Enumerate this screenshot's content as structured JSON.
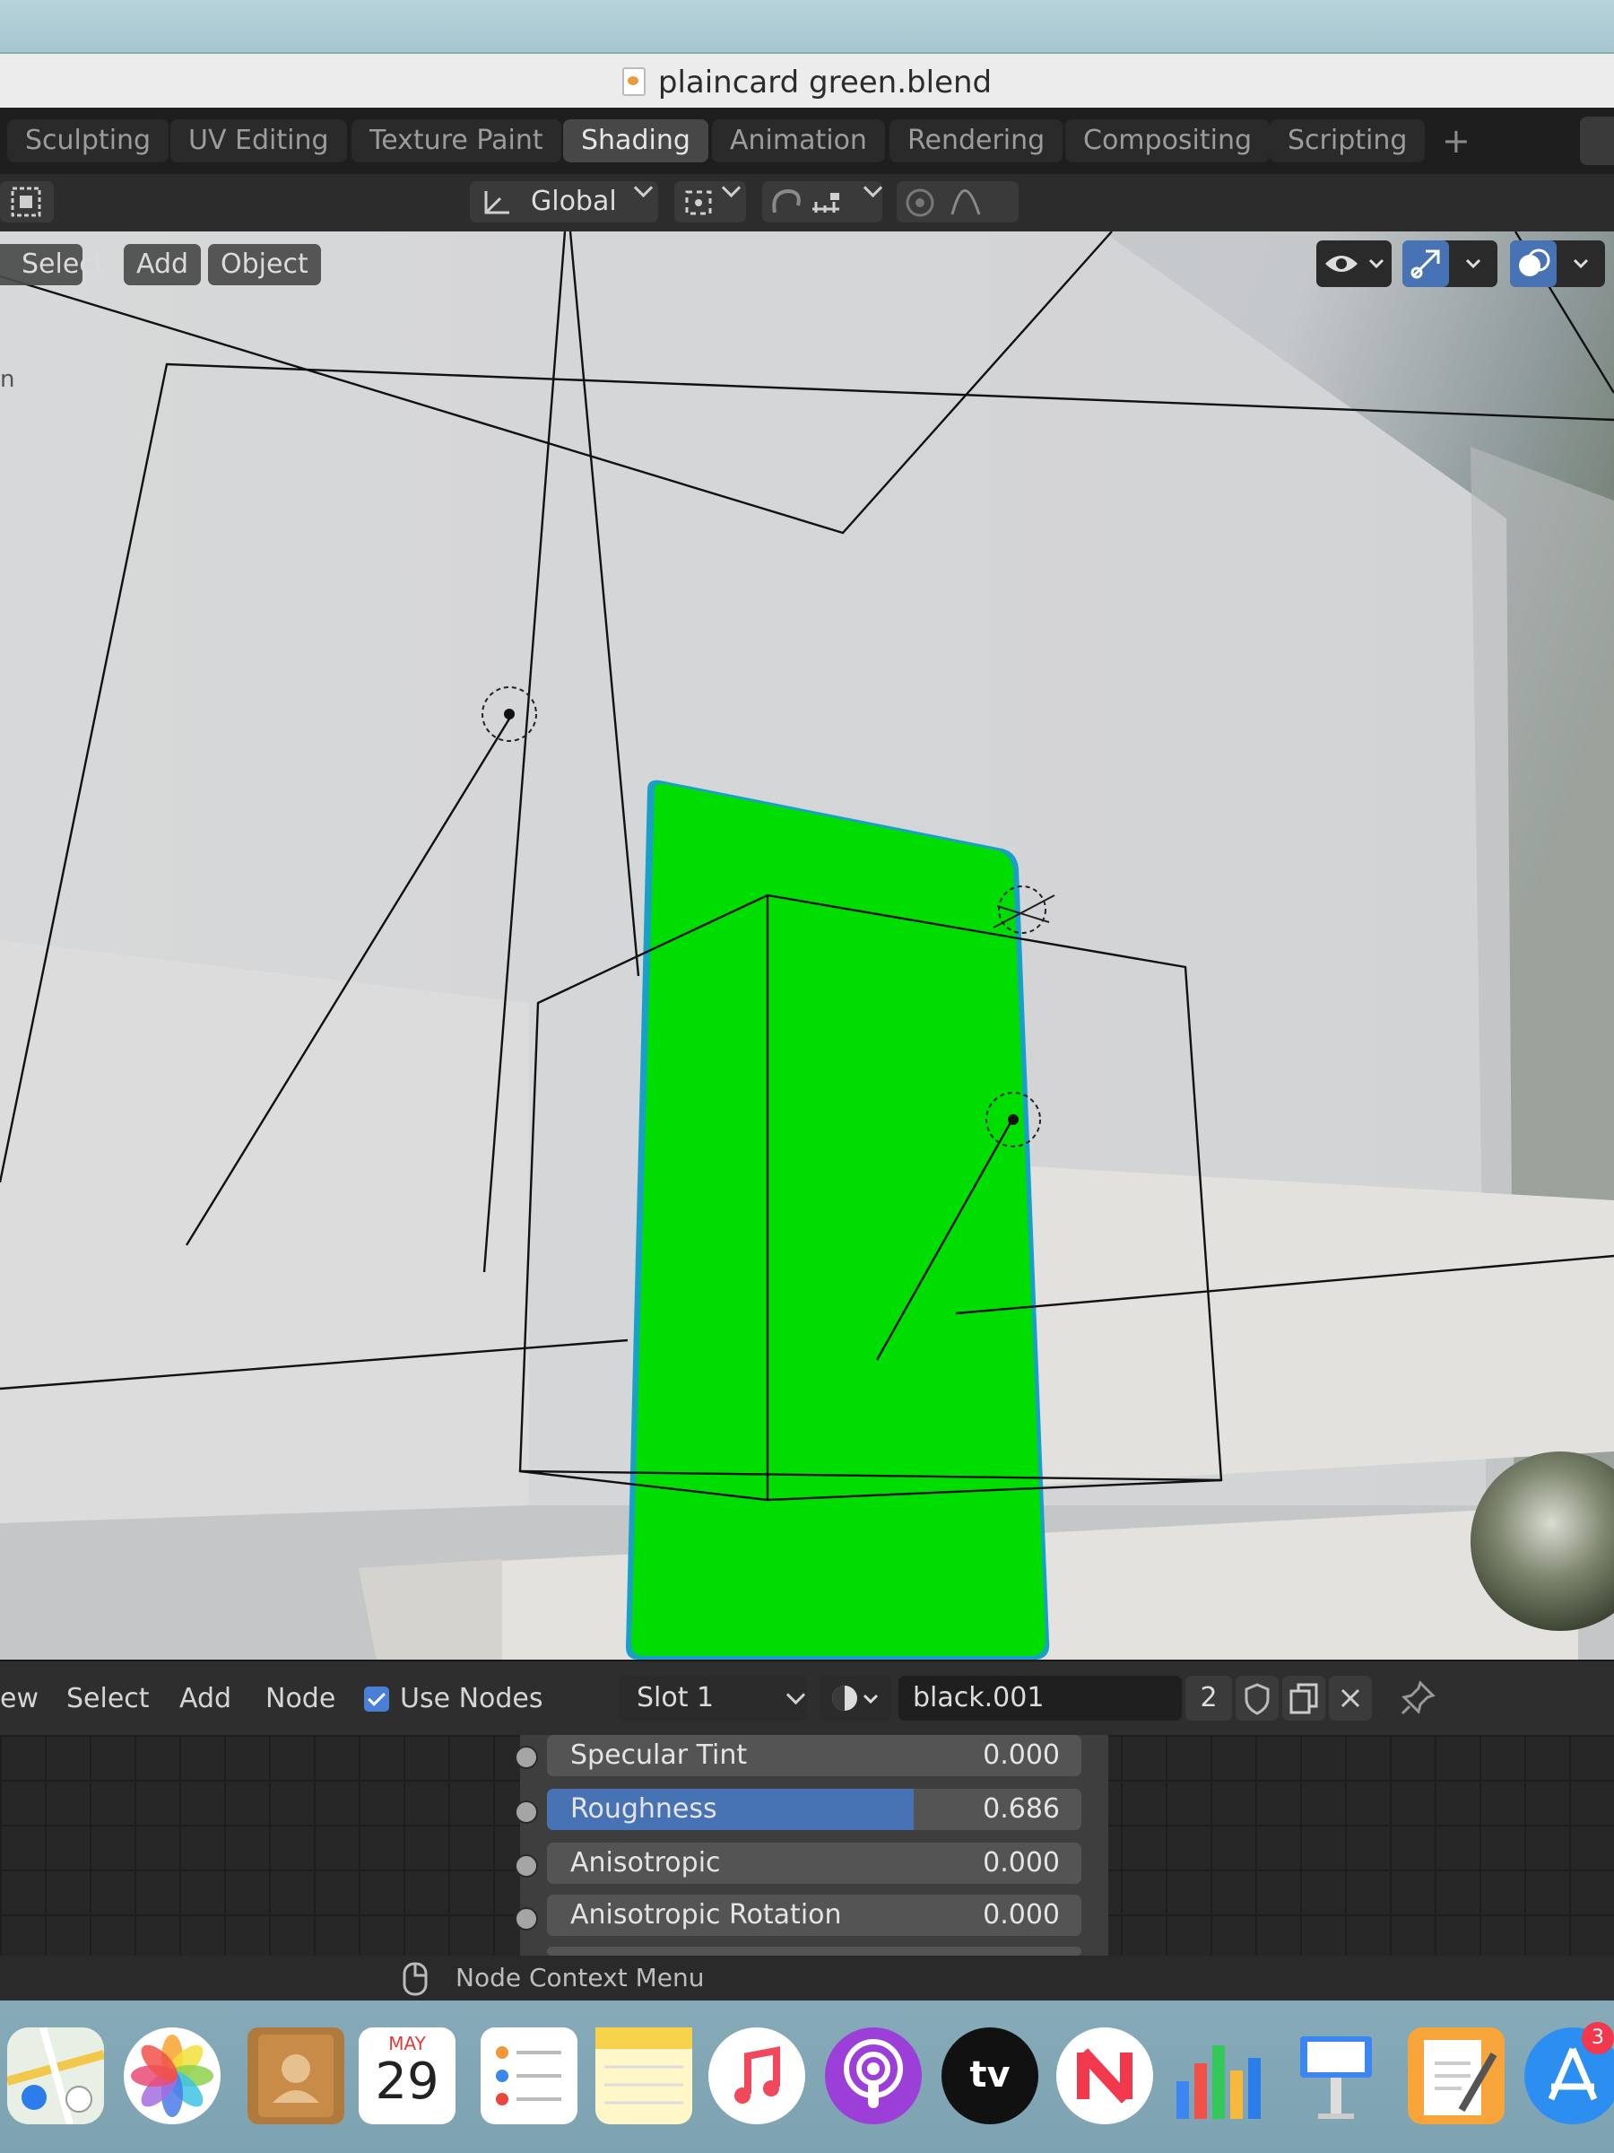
{
  "window": {
    "title": "plaincard green.blend"
  },
  "workspace_tabs": [
    {
      "label": "Sculpting",
      "active": false
    },
    {
      "label": "UV Editing",
      "active": false
    },
    {
      "label": "Texture Paint",
      "active": false
    },
    {
      "label": "Shading",
      "active": true
    },
    {
      "label": "Animation",
      "active": false
    },
    {
      "label": "Rendering",
      "active": false
    },
    {
      "label": "Compositing",
      "active": false
    },
    {
      "label": "Scripting",
      "active": false
    }
  ],
  "add_workspace_label": "+",
  "toolbar": {
    "orientation": "Global"
  },
  "viewport": {
    "menus": {
      "select": "Select",
      "add": "Add",
      "object": "Object"
    },
    "side_label": "n",
    "object_color": "#00dd00"
  },
  "node_editor": {
    "menus": {
      "view": "ew",
      "select": "Select",
      "add": "Add",
      "node": "Node"
    },
    "use_nodes": {
      "label": "Use Nodes",
      "checked": true
    },
    "slot": "Slot 1",
    "material_name": "black.001",
    "user_count": "2",
    "properties": [
      {
        "name": "Specular Tint",
        "value": "0.000",
        "fraction": 0
      },
      {
        "name": "Roughness",
        "value": "0.686",
        "fraction": 0.686
      },
      {
        "name": "Anisotropic",
        "value": "0.000",
        "fraction": 0
      },
      {
        "name": "Anisotropic Rotation",
        "value": "0.000",
        "fraction": 0
      }
    ]
  },
  "status_bar": {
    "hint": "Node Context Menu"
  },
  "dock": {
    "calendar": {
      "month": "MAY",
      "day": "29"
    },
    "appletv_label": "tv",
    "app_store_badge": "3"
  },
  "accent_color": "#4772b3"
}
